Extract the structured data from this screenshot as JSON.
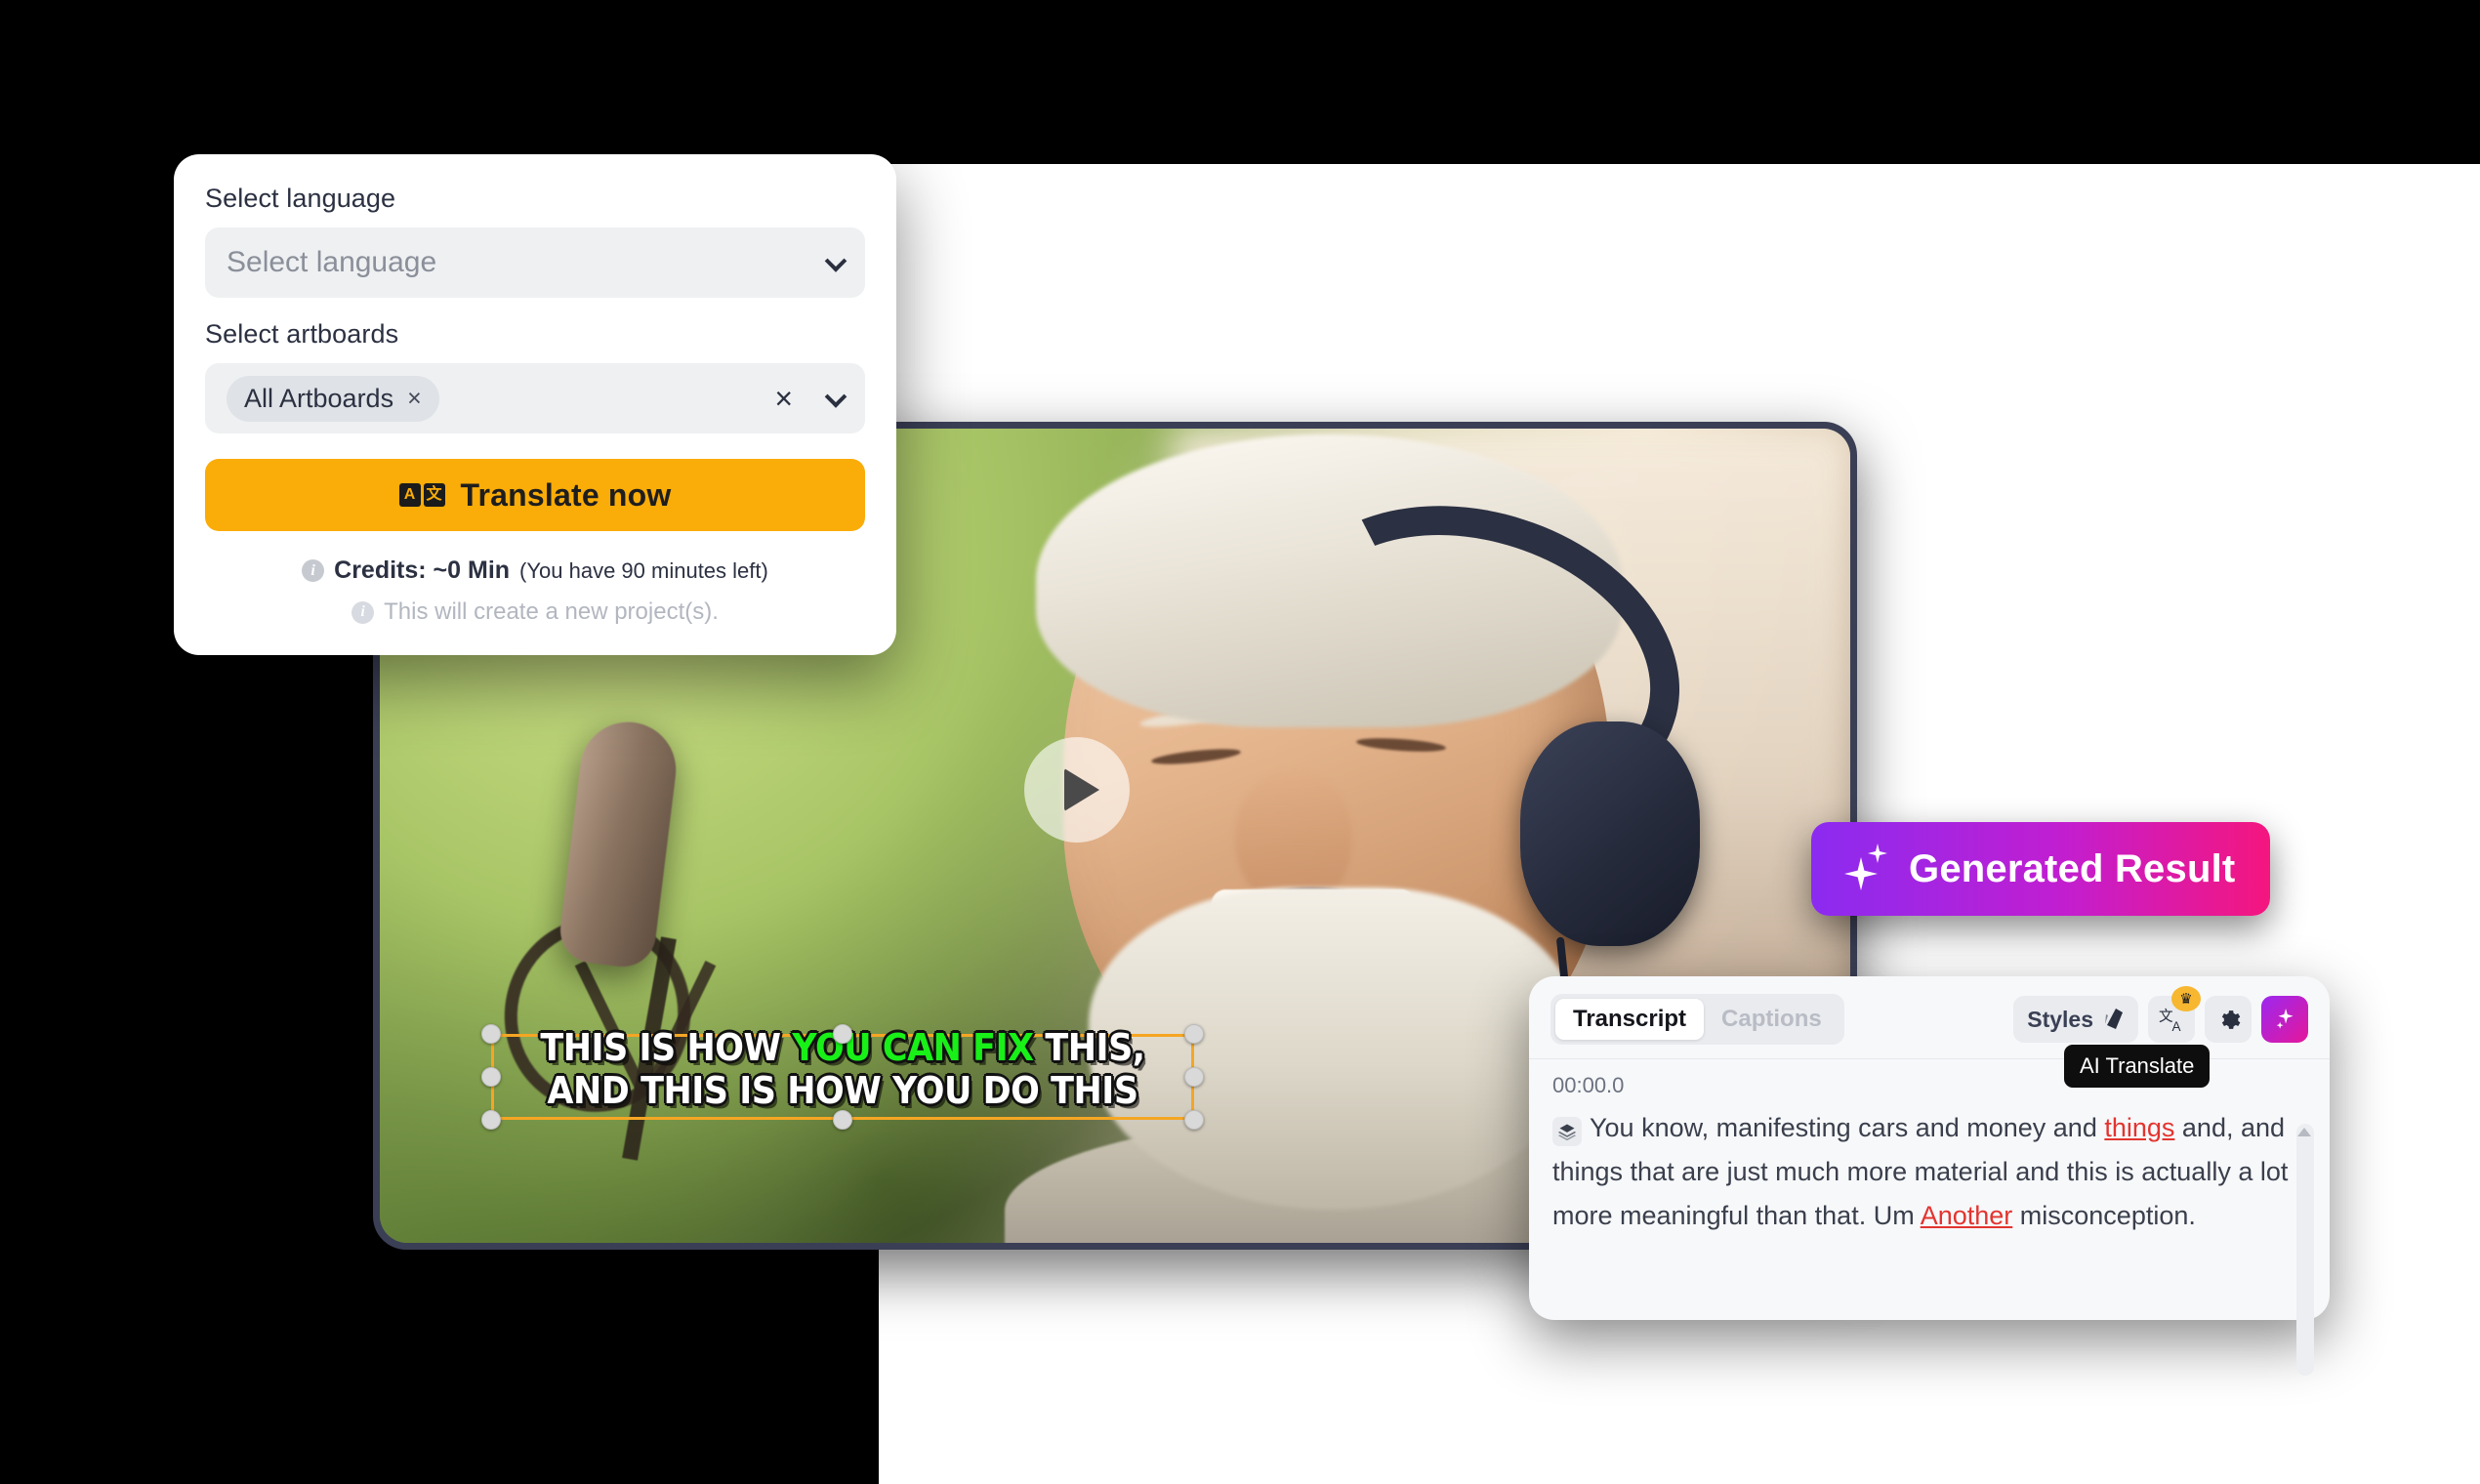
{
  "translate_panel": {
    "language_label": "Select language",
    "language_placeholder": "Select language",
    "artboards_label": "Select artboards",
    "artboard_chip": "All Artboards",
    "chip_remove": "×",
    "clear_all": "×",
    "translate_button": "Translate now",
    "translate_icon_a": "A",
    "translate_icon_cjk": "文",
    "credits_main": "Credits: ~0 Min",
    "credits_sub": "(You have 90 minutes left)",
    "project_note": "This will create a new project(s)."
  },
  "video": {
    "caption_line1_part1": "THIS IS HOW ",
    "caption_line1_highlight": "YOU CAN FIX",
    "caption_line1_part2": " THIS,",
    "caption_line2": "AND THIS IS HOW YOU DO THIS",
    "highlight_color": "#18f018",
    "selection_color": "#f5a623"
  },
  "generated_badge": {
    "label": "Generated Result",
    "gradient_from": "#8b2bf0",
    "gradient_to": "#f5167e"
  },
  "transcript": {
    "tabs": [
      {
        "label": "Transcript",
        "active": true
      },
      {
        "label": "Captions",
        "active": false
      }
    ],
    "tools": {
      "styles_label": "Styles",
      "ai_translate_tooltip": "AI Translate",
      "crown_badge": "♛"
    },
    "timestamp": "00:00.0",
    "text_part1": "You know, manifesting cars and money and ",
    "text_err1": "things",
    "text_part2": " and, and things that are just much more material and this is actually a lot more meaningful than that. Um ",
    "text_err2": "Another",
    "text_part3": " misconception."
  }
}
